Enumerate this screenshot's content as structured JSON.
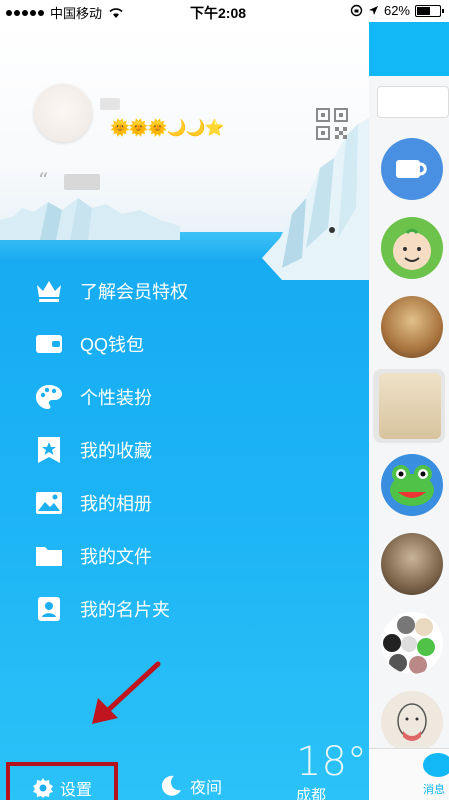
{
  "status_bar": {
    "carrier": "中国移动",
    "time": "下午2:08",
    "battery": "62%",
    "battery_level": 0.62
  },
  "profile": {
    "level_icons": "🌞🌞🌞🌙🌙⭐",
    "quote_mark": "“"
  },
  "menu": {
    "items": [
      {
        "label": "了解会员特权",
        "icon": "crown-icon"
      },
      {
        "label": "QQ钱包",
        "icon": "wallet-icon"
      },
      {
        "label": "个性装扮",
        "icon": "palette-icon"
      },
      {
        "label": "我的收藏",
        "icon": "bookmark-star-icon"
      },
      {
        "label": "我的相册",
        "icon": "photo-icon"
      },
      {
        "label": "我的文件",
        "icon": "folder-icon"
      },
      {
        "label": "我的名片夹",
        "icon": "contact-card-icon"
      }
    ]
  },
  "bottom": {
    "settings_label": "设置",
    "night_label": "夜间",
    "temperature": "18°",
    "city": "成都"
  },
  "right_panel": {
    "tab_label": "消息"
  },
  "colors": {
    "accent": "#12b7f5",
    "highlight_border": "#b3111c"
  }
}
